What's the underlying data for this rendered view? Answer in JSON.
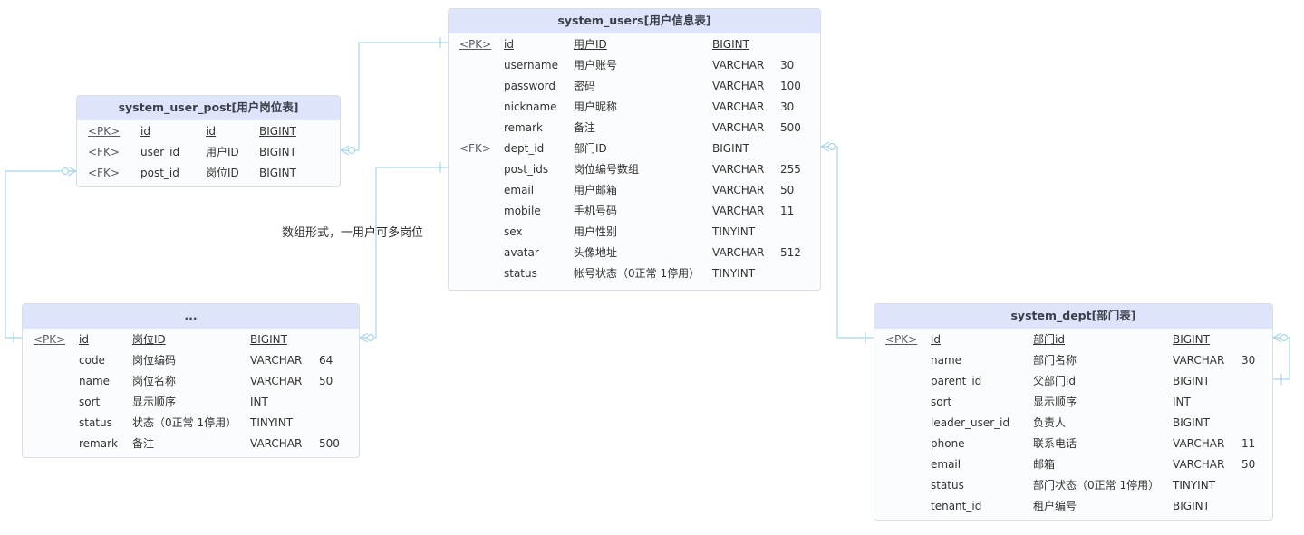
{
  "diagram": {
    "annotation": "数组形式，一用户可多岗位",
    "line_color": "#a9d6ee",
    "header_color": "#dde4fc",
    "entities": [
      {
        "id": "system_users",
        "title": "system_users[用户信息表]",
        "rows": [
          {
            "key": "<PK>",
            "name": "id",
            "comment": "用户ID",
            "type": "BIGINT",
            "length": ""
          },
          {
            "key": "",
            "name": "username",
            "comment": "用户账号",
            "type": "VARCHAR",
            "length": "30"
          },
          {
            "key": "",
            "name": "password",
            "comment": "密码",
            "type": "VARCHAR",
            "length": "100"
          },
          {
            "key": "",
            "name": "nickname",
            "comment": "用户昵称",
            "type": "VARCHAR",
            "length": "30"
          },
          {
            "key": "",
            "name": "remark",
            "comment": "备注",
            "type": "VARCHAR",
            "length": "500"
          },
          {
            "key": "<FK>",
            "name": "dept_id",
            "comment": "部门ID",
            "type": "BIGINT",
            "length": ""
          },
          {
            "key": "",
            "name": "post_ids",
            "comment": "岗位编号数组",
            "type": "VARCHAR",
            "length": "255"
          },
          {
            "key": "",
            "name": "email",
            "comment": "用户邮箱",
            "type": "VARCHAR",
            "length": "50"
          },
          {
            "key": "",
            "name": "mobile",
            "comment": "手机号码",
            "type": "VARCHAR",
            "length": "11"
          },
          {
            "key": "",
            "name": "sex",
            "comment": "用户性别",
            "type": "TINYINT",
            "length": ""
          },
          {
            "key": "",
            "name": "avatar",
            "comment": "头像地址",
            "type": "VARCHAR",
            "length": "512"
          },
          {
            "key": "",
            "name": "status",
            "comment": "帐号状态（0正常 1停用）",
            "type": "TINYINT",
            "length": ""
          }
        ]
      },
      {
        "id": "system_user_post",
        "title": "system_user_post[用户岗位表]",
        "rows": [
          {
            "key": "<PK>",
            "name": "id",
            "comment": "id",
            "type": "BIGINT",
            "length": ""
          },
          {
            "key": "<FK>",
            "name": "user_id",
            "comment": "用户ID",
            "type": "BIGINT",
            "length": ""
          },
          {
            "key": "<FK>",
            "name": "post_id",
            "comment": "岗位ID",
            "type": "BIGINT",
            "length": ""
          }
        ]
      },
      {
        "id": "system_post",
        "title": "...",
        "rows": [
          {
            "key": "<PK>",
            "name": "id",
            "comment": "岗位ID",
            "type": "BIGINT",
            "length": ""
          },
          {
            "key": "",
            "name": "code",
            "comment": "岗位编码",
            "type": "VARCHAR",
            "length": "64"
          },
          {
            "key": "",
            "name": "name",
            "comment": "岗位名称",
            "type": "VARCHAR",
            "length": "50"
          },
          {
            "key": "",
            "name": "sort",
            "comment": "显示顺序",
            "type": "INT",
            "length": ""
          },
          {
            "key": "",
            "name": "status",
            "comment": "状态（0正常 1停用）",
            "type": "TINYINT",
            "length": ""
          },
          {
            "key": "",
            "name": "remark",
            "comment": "备注",
            "type": "VARCHAR",
            "length": "500"
          }
        ]
      },
      {
        "id": "system_dept",
        "title": "system_dept[部门表]",
        "rows": [
          {
            "key": "<PK>",
            "name": "id",
            "comment": "部门id",
            "type": "BIGINT",
            "length": ""
          },
          {
            "key": "",
            "name": "name",
            "comment": "部门名称",
            "type": "VARCHAR",
            "length": "30"
          },
          {
            "key": "",
            "name": "parent_id",
            "comment": "父部门id",
            "type": "BIGINT",
            "length": ""
          },
          {
            "key": "",
            "name": "sort",
            "comment": "显示顺序",
            "type": "INT",
            "length": ""
          },
          {
            "key": "",
            "name": "leader_user_id",
            "comment": "负责人",
            "type": "BIGINT",
            "length": ""
          },
          {
            "key": "",
            "name": "phone",
            "comment": "联系电话",
            "type": "VARCHAR",
            "length": "11"
          },
          {
            "key": "",
            "name": "email",
            "comment": "邮箱",
            "type": "VARCHAR",
            "length": "50"
          },
          {
            "key": "",
            "name": "status",
            "comment": "部门状态（0正常 1停用）",
            "type": "TINYINT",
            "length": ""
          },
          {
            "key": "",
            "name": "tenant_id",
            "comment": "租户编号",
            "type": "BIGINT",
            "length": ""
          }
        ]
      }
    ]
  }
}
